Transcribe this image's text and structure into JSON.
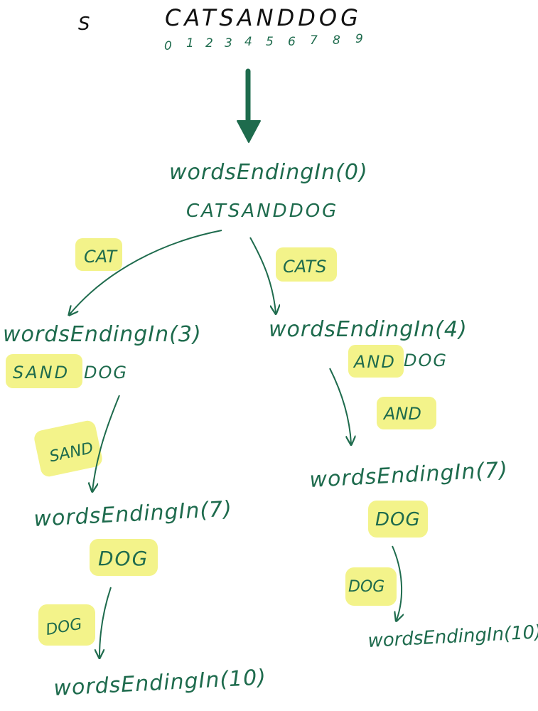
{
  "header": {
    "var_name": "S",
    "string": "CATSANDDOG",
    "indices": [
      "0",
      "1",
      "2",
      "3",
      "4",
      "5",
      "6",
      "7",
      "8",
      "9"
    ]
  },
  "colors": {
    "ink": "#1e6b4d",
    "black": "#111111",
    "highlight": "#f3f38a"
  },
  "tree": {
    "root": {
      "call": "wordsEndingIn(0)",
      "remaining": "CATSANDDOG"
    },
    "edge_cat": "CAT",
    "edge_cats": "CATS",
    "left": {
      "call": "wordsEndingIn(3)",
      "remaining_hl": "SAND",
      "remaining_rest": "DOG"
    },
    "edge_sand": "SAND",
    "left_mid": {
      "call": "wordsEndingIn(7)",
      "remaining": "DOG"
    },
    "edge_dog_left": "DOG",
    "left_leaf": {
      "call": "wordsEndingIn(10)"
    },
    "right": {
      "call": "wordsEndingIn(4)",
      "remaining_hl": "AND",
      "remaining_rest": "DOG"
    },
    "edge_and": "AND",
    "right_mid": {
      "call": "wordsEndingIn(7)",
      "remaining": "DOG"
    },
    "edge_dog_right": "DOG",
    "right_leaf": {
      "call": "wordsEndingIn(10)"
    }
  }
}
